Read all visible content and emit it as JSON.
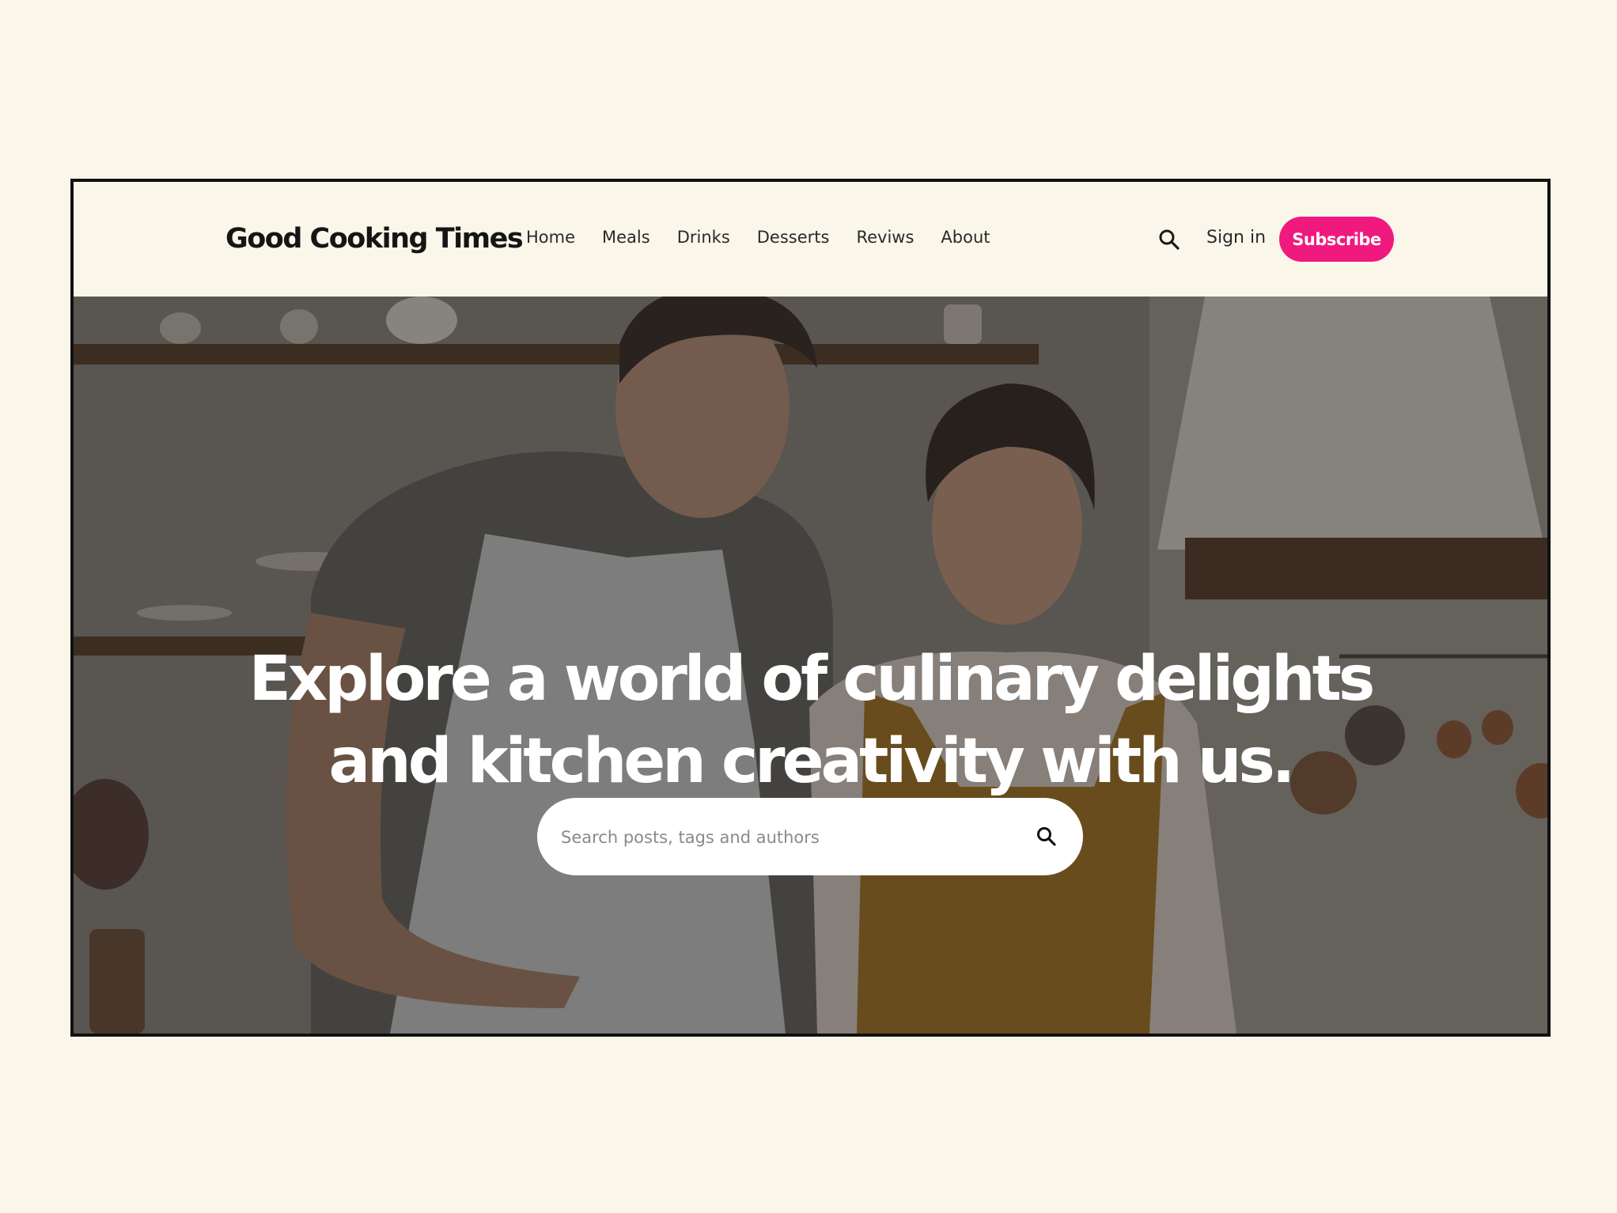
{
  "brand": {
    "name": "Good Cooking Times"
  },
  "nav": {
    "links": [
      {
        "label": "Home"
      },
      {
        "label": "Meals"
      },
      {
        "label": "Drinks"
      },
      {
        "label": "Desserts"
      },
      {
        "label": "Reviws"
      },
      {
        "label": "About"
      }
    ],
    "search_icon": "search-icon",
    "signin_label": "Sign in",
    "subscribe_label": "Subscribe"
  },
  "hero": {
    "headline_line1": "Explore a world of culinary delights",
    "headline_line2": "and kitchen creativity with us.",
    "search": {
      "placeholder": "Search posts, tags and authors",
      "value": "",
      "icon": "search-icon"
    }
  },
  "colors": {
    "page_background": "#faf6ea",
    "accent": "#f0197d",
    "frame_border": "#111111"
  }
}
